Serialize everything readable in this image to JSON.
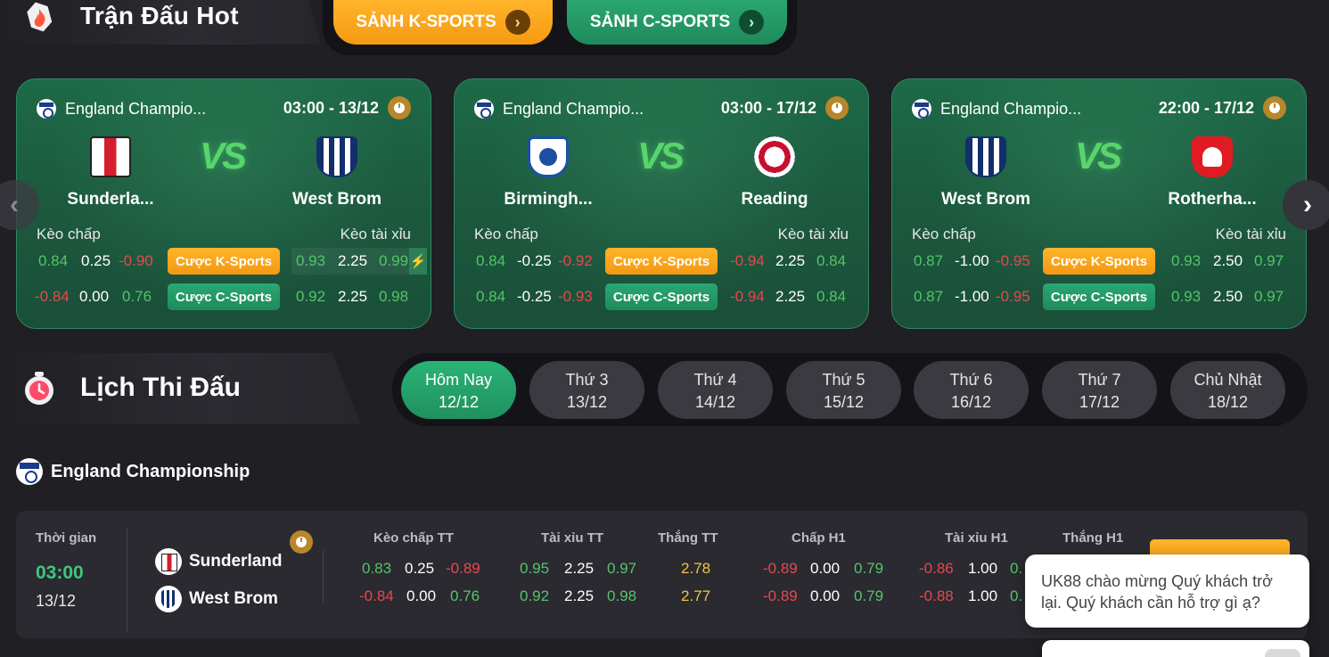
{
  "hot": {
    "title": "Trận Đấu Hot",
    "lobby_k": "SẢNH K-SPORTS",
    "lobby_c": "SẢNH C-SPORTS"
  },
  "cards": [
    {
      "league": "England Champio...",
      "time": "03:00 - 13/12",
      "home": "Sunderla...",
      "away": "West Brom",
      "vs": "VS",
      "handicap_label": "Kèo chấp",
      "ou_label": "Kèo tài xỉu",
      "row1": [
        "0.84",
        "0.25",
        "-0.90",
        "0.93",
        "2.25",
        "0.99"
      ],
      "row2": [
        "-0.84",
        "0.00",
        "0.76",
        "0.92",
        "2.25",
        "0.98"
      ],
      "btn_k": "Cược K-Sports",
      "btn_c": "Cược C-Sports",
      "bolt": "⚡"
    },
    {
      "league": "England Champio...",
      "time": "03:00 - 17/12",
      "home": "Birmingh...",
      "away": "Reading",
      "vs": "VS",
      "handicap_label": "Kèo chấp",
      "ou_label": "Kèo tài xỉu",
      "row1": [
        "0.84",
        "-0.25",
        "-0.92",
        "-0.94",
        "2.25",
        "0.84"
      ],
      "row2": [
        "0.84",
        "-0.25",
        "-0.93",
        "-0.94",
        "2.25",
        "0.84"
      ],
      "btn_k": "Cược K-Sports",
      "btn_c": "Cược C-Sports"
    },
    {
      "league": "England Champio...",
      "time": "22:00 - 17/12",
      "home": "West Brom",
      "away": "Rotherha...",
      "vs": "VS",
      "handicap_label": "Kèo chấp",
      "ou_label": "Kèo tài xỉu",
      "row1": [
        "0.87",
        "-1.00",
        "-0.95",
        "0.93",
        "2.50",
        "0.97"
      ],
      "row2": [
        "0.87",
        "-1.00",
        "-0.95",
        "0.93",
        "2.50",
        "0.97"
      ],
      "btn_k": "Cược K-Sports",
      "btn_c": "Cược C-Sports"
    }
  ],
  "nav": {
    "prev": "‹",
    "next": "›"
  },
  "schedule": {
    "title": "Lịch Thi Đấu",
    "days": [
      {
        "name": "Hôm Nay",
        "date": "12/12",
        "active": true
      },
      {
        "name": "Thứ 3",
        "date": "13/12"
      },
      {
        "name": "Thứ 4",
        "date": "14/12"
      },
      {
        "name": "Thứ 5",
        "date": "15/12"
      },
      {
        "name": "Thứ 6",
        "date": "16/12"
      },
      {
        "name": "Thứ 7",
        "date": "17/12"
      },
      {
        "name": "Chủ Nhật",
        "date": "18/12"
      }
    ]
  },
  "league": {
    "name": "England Championship"
  },
  "match": {
    "time_label": "Thời gian",
    "time": "03:00",
    "date": "13/12",
    "home": "Sunderland",
    "away": "West Brom",
    "headers": [
      "Kèo chấp TT",
      "Tài xỉu TT",
      "Thắng TT",
      "Chấp H1",
      "Tài xỉu H1",
      "Thắng H1"
    ],
    "hc_ft": [
      [
        "0.83",
        "0.25",
        "-0.89"
      ],
      [
        "-0.84",
        "0.00",
        "0.76"
      ]
    ],
    "ou_ft": [
      [
        "0.95",
        "2.25",
        "0.97"
      ],
      [
        "0.92",
        "2.25",
        "0.98"
      ]
    ],
    "win_ft": [
      "2.78",
      "2.77"
    ],
    "hc_h1": [
      [
        "-0.89",
        "0.00",
        "0.79"
      ],
      [
        "-0.89",
        "0.00",
        "0.79"
      ]
    ],
    "ou_h1": [
      [
        "-0.86",
        "1.00",
        "0."
      ],
      [
        "-0.88",
        "1.00",
        "0."
      ]
    ]
  },
  "chat": {
    "message": "UK88 chào mừng Quý khách trở lại. Quý khách cần hỗ trợ gì ạ?"
  }
}
